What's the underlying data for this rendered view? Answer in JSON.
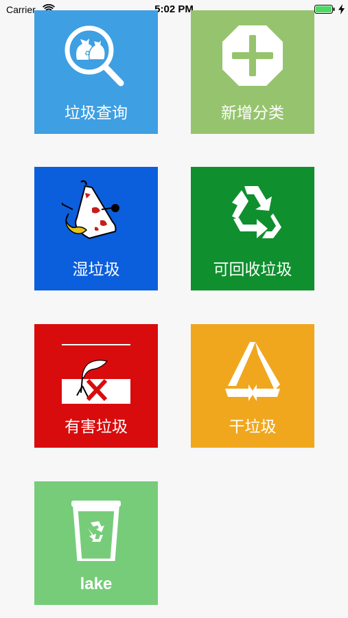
{
  "status_bar": {
    "carrier": "Carrier",
    "time": "5:02 PM",
    "wifi_icon": "wifi-icon",
    "battery_icon": "battery-icon",
    "charge_icon": "charging-bolt-icon"
  },
  "tiles": [
    {
      "label": "垃圾查询",
      "color": "#3e9fe3",
      "icon": "magnifier-garbage-bags-icon"
    },
    {
      "label": "新增分类",
      "color": "#96c46e",
      "icon": "octagon-plus-icon"
    },
    {
      "label": "湿垃圾",
      "color": "#0c5fdc",
      "icon": "wet-waste-icon"
    },
    {
      "label": "可回收垃圾",
      "color": "#0f8f2e",
      "icon": "recycle-icon"
    },
    {
      "label": "有害垃圾",
      "color": "#d80c0d",
      "icon": "hazardous-waste-icon"
    },
    {
      "label": "干垃圾",
      "color": "#f0a71e",
      "icon": "dry-waste-triangle-icon"
    },
    {
      "label": "lake",
      "color": "#77cc7a",
      "icon": "recycle-bin-icon"
    }
  ]
}
